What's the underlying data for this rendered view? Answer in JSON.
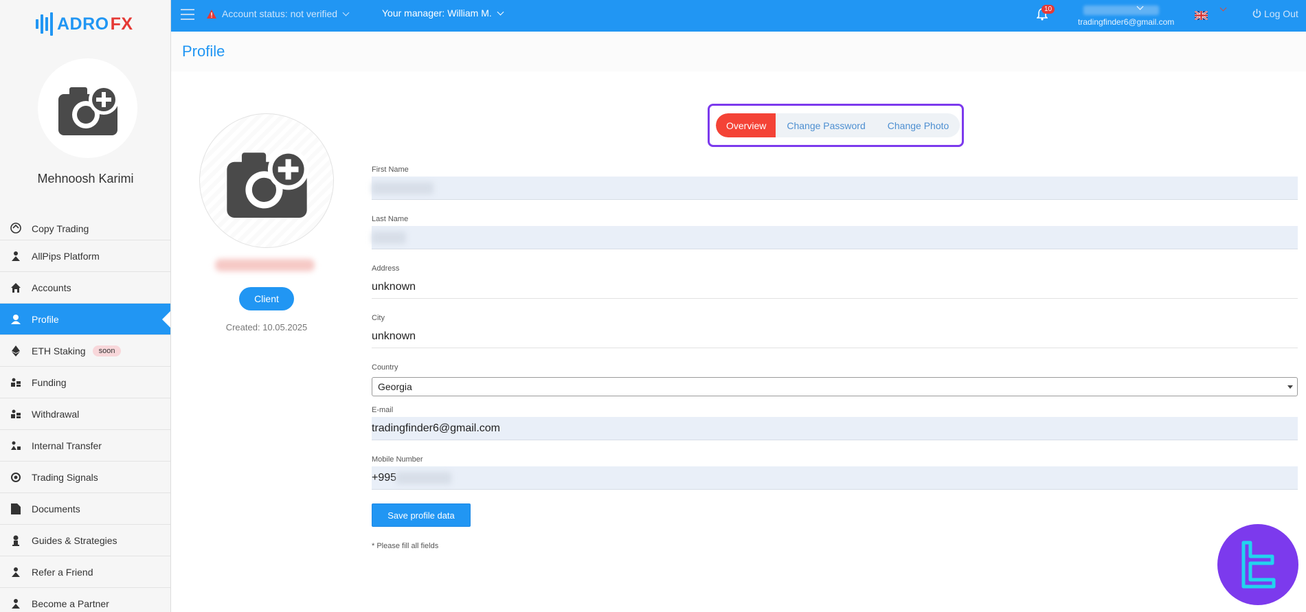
{
  "brand": {
    "logo_left": "ADRO",
    "logo_right": "FX"
  },
  "sidebar": {
    "user_name": "Mehnoosh Karimi",
    "items": [
      {
        "label": "Copy Trading",
        "icon": "copy-trading-icon"
      },
      {
        "label": "AllPips Platform",
        "icon": "platform-icon"
      },
      {
        "label": "Accounts",
        "icon": "home-icon"
      },
      {
        "label": "Profile",
        "icon": "user-icon",
        "active": true
      },
      {
        "label": "ETH Staking",
        "icon": "ethereum-icon",
        "badge": "soon"
      },
      {
        "label": "Funding",
        "icon": "funding-icon"
      },
      {
        "label": "Withdrawal",
        "icon": "withdrawal-icon"
      },
      {
        "label": "Internal Transfer",
        "icon": "transfer-icon"
      },
      {
        "label": "Trading Signals",
        "icon": "signals-icon"
      },
      {
        "label": "Documents",
        "icon": "document-icon"
      },
      {
        "label": "Guides & Strategies",
        "icon": "guides-icon"
      },
      {
        "label": "Refer a Friend",
        "icon": "refer-icon"
      },
      {
        "label": "Become a Partner",
        "icon": "partner-icon"
      }
    ]
  },
  "topbar": {
    "account_status": "Account status: not verified",
    "manager": "Your manager: William M.",
    "notifications_count": "10",
    "user_email": "tradingfinder6@gmail.com",
    "logout": "Log Out"
  },
  "page": {
    "title": "Profile"
  },
  "profile": {
    "role_button": "Client",
    "created": "Created: 10.05.2025"
  },
  "tabs": [
    {
      "label": "Overview",
      "active": true
    },
    {
      "label": "Change Password"
    },
    {
      "label": "Change Photo"
    }
  ],
  "form": {
    "first_name_label": "First Name",
    "last_name_label": "Last Name",
    "address_label": "Address",
    "address_value": "unknown",
    "city_label": "City",
    "city_value": "unknown",
    "country_label": "Country",
    "country_value": "Georgia",
    "email_label": "E-mail",
    "email_value": "tradingfinder6@gmail.com",
    "mobile_label": "Mobile Number",
    "mobile_prefix": "+995",
    "save_button": "Save profile data",
    "note": "* Please fill all fields"
  },
  "colors": {
    "primary": "#2196f3",
    "active_tab": "#f44336",
    "highlight": "#7c3aed",
    "logo_fx": "#e53935"
  }
}
